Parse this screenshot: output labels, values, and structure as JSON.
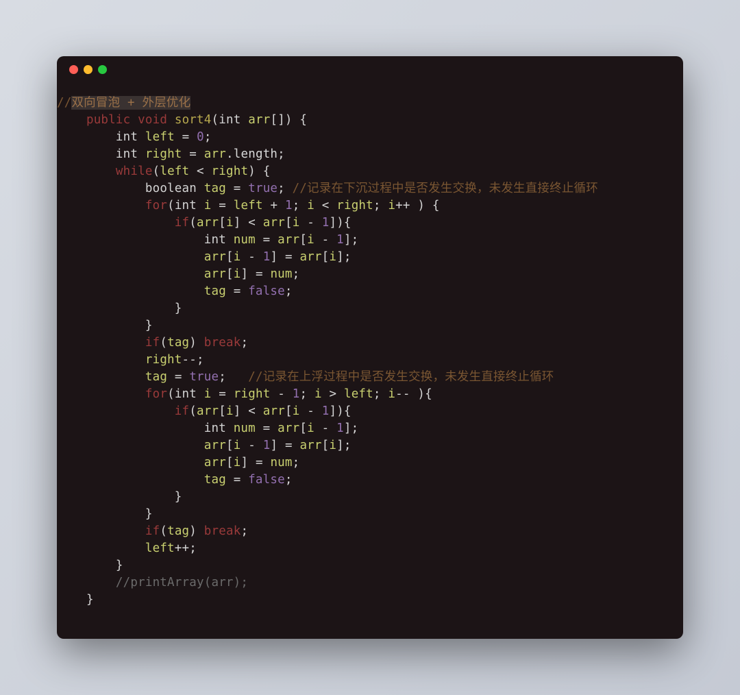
{
  "window": {
    "traffic_lights": [
      "close",
      "minimize",
      "zoom"
    ]
  },
  "code": {
    "tokens": [
      [
        [
          "c-comment",
          "//"
        ],
        [
          "c-comment-hl",
          "双向冒泡 + 外层优化"
        ]
      ],
      [
        [
          "",
          "    "
        ],
        [
          "c-keyword",
          "public"
        ],
        [
          "",
          " "
        ],
        [
          "c-keyword",
          "void"
        ],
        [
          "",
          " "
        ],
        [
          "c-funcname",
          "sort4"
        ],
        [
          "c-paren",
          "("
        ],
        [
          "c-type",
          "int"
        ],
        [
          "",
          " "
        ],
        [
          "c-var",
          "arr"
        ],
        [
          "c-paren",
          "[]) {"
        ]
      ],
      [
        [
          "",
          "        "
        ],
        [
          "c-type",
          "int"
        ],
        [
          "",
          " "
        ],
        [
          "c-var",
          "left"
        ],
        [
          "",
          " "
        ],
        [
          "c-op",
          "="
        ],
        [
          "",
          " "
        ],
        [
          "c-num",
          "0"
        ],
        [
          "",
          ";"
        ]
      ],
      [
        [
          "",
          "        "
        ],
        [
          "c-type",
          "int"
        ],
        [
          "",
          " "
        ],
        [
          "c-var",
          "right"
        ],
        [
          "",
          " "
        ],
        [
          "c-op",
          "="
        ],
        [
          "",
          " "
        ],
        [
          "c-var",
          "arr"
        ],
        [
          "",
          ".length;"
        ]
      ],
      [
        [
          "",
          "        "
        ],
        [
          "c-keyword",
          "while"
        ],
        [
          "c-paren",
          "("
        ],
        [
          "c-var",
          "left"
        ],
        [
          "",
          " "
        ],
        [
          "c-op",
          "<"
        ],
        [
          "",
          " "
        ],
        [
          "c-var",
          "right"
        ],
        [
          "c-paren",
          ") {"
        ]
      ],
      [
        [
          "",
          "            "
        ],
        [
          "c-type",
          "boolean"
        ],
        [
          "",
          " "
        ],
        [
          "c-var",
          "tag"
        ],
        [
          "",
          " "
        ],
        [
          "c-op",
          "="
        ],
        [
          "",
          " "
        ],
        [
          "c-bool",
          "true"
        ],
        [
          "",
          "; "
        ],
        [
          "c-comment",
          "//记录在下沉过程中是否发生交换，未发生直接终止循环"
        ]
      ],
      [
        [
          "",
          "            "
        ],
        [
          "c-keyword",
          "for"
        ],
        [
          "c-paren",
          "("
        ],
        [
          "c-type",
          "int"
        ],
        [
          "",
          " "
        ],
        [
          "c-var",
          "i"
        ],
        [
          "",
          " "
        ],
        [
          "c-op",
          "="
        ],
        [
          "",
          " "
        ],
        [
          "c-var",
          "left"
        ],
        [
          "",
          " "
        ],
        [
          "c-op",
          "+"
        ],
        [
          "",
          " "
        ],
        [
          "c-num",
          "1"
        ],
        [
          "",
          "; "
        ],
        [
          "c-var",
          "i"
        ],
        [
          "",
          " "
        ],
        [
          "c-op",
          "<"
        ],
        [
          "",
          " "
        ],
        [
          "c-var",
          "right"
        ],
        [
          "",
          "; "
        ],
        [
          "c-var",
          "i"
        ],
        [
          "c-op",
          "++"
        ],
        [
          "",
          " "
        ],
        [
          "c-paren",
          ") {"
        ]
      ],
      [
        [
          "",
          "                "
        ],
        [
          "c-keyword",
          "if"
        ],
        [
          "c-paren",
          "("
        ],
        [
          "c-var",
          "arr"
        ],
        [
          "c-paren",
          "["
        ],
        [
          "c-var",
          "i"
        ],
        [
          "c-paren",
          "]"
        ],
        [
          "",
          " "
        ],
        [
          "c-op",
          "<"
        ],
        [
          "",
          " "
        ],
        [
          "c-var",
          "arr"
        ],
        [
          "c-paren",
          "["
        ],
        [
          "c-var",
          "i"
        ],
        [
          "",
          " "
        ],
        [
          "c-op",
          "-"
        ],
        [
          "",
          " "
        ],
        [
          "c-num",
          "1"
        ],
        [
          "c-paren",
          "]){"
        ]
      ],
      [
        [
          "",
          "                    "
        ],
        [
          "c-type",
          "int"
        ],
        [
          "",
          " "
        ],
        [
          "c-var",
          "num"
        ],
        [
          "",
          " "
        ],
        [
          "c-op",
          "="
        ],
        [
          "",
          " "
        ],
        [
          "c-var",
          "arr"
        ],
        [
          "c-paren",
          "["
        ],
        [
          "c-var",
          "i"
        ],
        [
          "",
          " "
        ],
        [
          "c-op",
          "-"
        ],
        [
          "",
          " "
        ],
        [
          "c-num",
          "1"
        ],
        [
          "c-paren",
          "]"
        ],
        [
          "",
          ";"
        ]
      ],
      [
        [
          "",
          "                    "
        ],
        [
          "c-var",
          "arr"
        ],
        [
          "c-paren",
          "["
        ],
        [
          "c-var",
          "i"
        ],
        [
          "",
          " "
        ],
        [
          "c-op",
          "-"
        ],
        [
          "",
          " "
        ],
        [
          "c-num",
          "1"
        ],
        [
          "c-paren",
          "]"
        ],
        [
          "",
          " "
        ],
        [
          "c-op",
          "="
        ],
        [
          "",
          " "
        ],
        [
          "c-var",
          "arr"
        ],
        [
          "c-paren",
          "["
        ],
        [
          "c-var",
          "i"
        ],
        [
          "c-paren",
          "]"
        ],
        [
          "",
          ";"
        ]
      ],
      [
        [
          "",
          "                    "
        ],
        [
          "c-var",
          "arr"
        ],
        [
          "c-paren",
          "["
        ],
        [
          "c-var",
          "i"
        ],
        [
          "c-paren",
          "]"
        ],
        [
          "",
          " "
        ],
        [
          "c-op",
          "="
        ],
        [
          "",
          " "
        ],
        [
          "c-var",
          "num"
        ],
        [
          "",
          ";"
        ]
      ],
      [
        [
          "",
          "                    "
        ],
        [
          "c-var",
          "tag"
        ],
        [
          "",
          " "
        ],
        [
          "c-op",
          "="
        ],
        [
          "",
          " "
        ],
        [
          "c-bool",
          "false"
        ],
        [
          "",
          ";"
        ]
      ],
      [
        [
          "",
          "                "
        ],
        [
          "c-paren",
          "}"
        ]
      ],
      [
        [
          "",
          "            "
        ],
        [
          "c-paren",
          "}"
        ]
      ],
      [
        [
          "",
          "            "
        ],
        [
          "c-keyword",
          "if"
        ],
        [
          "c-paren",
          "("
        ],
        [
          "c-var",
          "tag"
        ],
        [
          "c-paren",
          ")"
        ],
        [
          "",
          " "
        ],
        [
          "c-break",
          "break"
        ],
        [
          "",
          ";"
        ]
      ],
      [
        [
          "",
          "            "
        ],
        [
          "c-var",
          "right"
        ],
        [
          "c-op",
          "--"
        ],
        [
          "",
          ";"
        ]
      ],
      [
        [
          "",
          "            "
        ],
        [
          "c-var",
          "tag"
        ],
        [
          "",
          " "
        ],
        [
          "c-op",
          "="
        ],
        [
          "",
          " "
        ],
        [
          "c-bool",
          "true"
        ],
        [
          "",
          "; "
        ],
        [
          "c-comment",
          "  //记录在上浮过程中是否发生交换，未发生直接终止循环"
        ]
      ],
      [
        [
          "",
          "            "
        ],
        [
          "c-keyword",
          "for"
        ],
        [
          "c-paren",
          "("
        ],
        [
          "c-type",
          "int"
        ],
        [
          "",
          " "
        ],
        [
          "c-var",
          "i"
        ],
        [
          "",
          " "
        ],
        [
          "c-op",
          "="
        ],
        [
          "",
          " "
        ],
        [
          "c-var",
          "right"
        ],
        [
          "",
          " "
        ],
        [
          "c-op",
          "-"
        ],
        [
          "",
          " "
        ],
        [
          "c-num",
          "1"
        ],
        [
          "",
          "; "
        ],
        [
          "c-var",
          "i"
        ],
        [
          "",
          " "
        ],
        [
          "c-op",
          ">"
        ],
        [
          "",
          " "
        ],
        [
          "c-var",
          "left"
        ],
        [
          "",
          "; "
        ],
        [
          "c-var",
          "i"
        ],
        [
          "c-op",
          "--"
        ],
        [
          "",
          " "
        ],
        [
          "c-paren",
          "){"
        ]
      ],
      [
        [
          "",
          "                "
        ],
        [
          "c-keyword",
          "if"
        ],
        [
          "c-paren",
          "("
        ],
        [
          "c-var",
          "arr"
        ],
        [
          "c-paren",
          "["
        ],
        [
          "c-var",
          "i"
        ],
        [
          "c-paren",
          "]"
        ],
        [
          "",
          " "
        ],
        [
          "c-op",
          "<"
        ],
        [
          "",
          " "
        ],
        [
          "c-var",
          "arr"
        ],
        [
          "c-paren",
          "["
        ],
        [
          "c-var",
          "i"
        ],
        [
          "",
          " "
        ],
        [
          "c-op",
          "-"
        ],
        [
          "",
          " "
        ],
        [
          "c-num",
          "1"
        ],
        [
          "c-paren",
          "]){"
        ]
      ],
      [
        [
          "",
          "                    "
        ],
        [
          "c-type",
          "int"
        ],
        [
          "",
          " "
        ],
        [
          "c-var",
          "num"
        ],
        [
          "",
          " "
        ],
        [
          "c-op",
          "="
        ],
        [
          "",
          " "
        ],
        [
          "c-var",
          "arr"
        ],
        [
          "c-paren",
          "["
        ],
        [
          "c-var",
          "i"
        ],
        [
          "",
          " "
        ],
        [
          "c-op",
          "-"
        ],
        [
          "",
          " "
        ],
        [
          "c-num",
          "1"
        ],
        [
          "c-paren",
          "]"
        ],
        [
          "",
          ";"
        ]
      ],
      [
        [
          "",
          "                    "
        ],
        [
          "c-var",
          "arr"
        ],
        [
          "c-paren",
          "["
        ],
        [
          "c-var",
          "i"
        ],
        [
          "",
          " "
        ],
        [
          "c-op",
          "-"
        ],
        [
          "",
          " "
        ],
        [
          "c-num",
          "1"
        ],
        [
          "c-paren",
          "]"
        ],
        [
          "",
          " "
        ],
        [
          "c-op",
          "="
        ],
        [
          "",
          " "
        ],
        [
          "c-var",
          "arr"
        ],
        [
          "c-paren",
          "["
        ],
        [
          "c-var",
          "i"
        ],
        [
          "c-paren",
          "]"
        ],
        [
          "",
          ";"
        ]
      ],
      [
        [
          "",
          "                    "
        ],
        [
          "c-var",
          "arr"
        ],
        [
          "c-paren",
          "["
        ],
        [
          "c-var",
          "i"
        ],
        [
          "c-paren",
          "]"
        ],
        [
          "",
          " "
        ],
        [
          "c-op",
          "="
        ],
        [
          "",
          " "
        ],
        [
          "c-var",
          "num"
        ],
        [
          "",
          ";"
        ]
      ],
      [
        [
          "",
          "                    "
        ],
        [
          "c-var",
          "tag"
        ],
        [
          "",
          " "
        ],
        [
          "c-op",
          "="
        ],
        [
          "",
          " "
        ],
        [
          "c-bool",
          "false"
        ],
        [
          "",
          ";"
        ]
      ],
      [
        [
          "",
          "                "
        ],
        [
          "c-paren",
          "}"
        ]
      ],
      [
        [
          "",
          "            "
        ],
        [
          "c-paren",
          "}"
        ]
      ],
      [
        [
          "",
          "            "
        ],
        [
          "c-keyword",
          "if"
        ],
        [
          "c-paren",
          "("
        ],
        [
          "c-var",
          "tag"
        ],
        [
          "c-paren",
          ")"
        ],
        [
          "",
          " "
        ],
        [
          "c-break",
          "break"
        ],
        [
          "",
          ";"
        ]
      ],
      [
        [
          "",
          "            "
        ],
        [
          "c-var",
          "left"
        ],
        [
          "c-op",
          "++"
        ],
        [
          "",
          ";"
        ]
      ],
      [
        [
          "",
          "        "
        ],
        [
          "c-paren",
          "}"
        ]
      ],
      [
        [
          "",
          "        "
        ],
        [
          "c-dim",
          "//printArray(arr);"
        ]
      ],
      [
        [
          "",
          "    "
        ],
        [
          "c-paren",
          "}"
        ]
      ]
    ]
  }
}
